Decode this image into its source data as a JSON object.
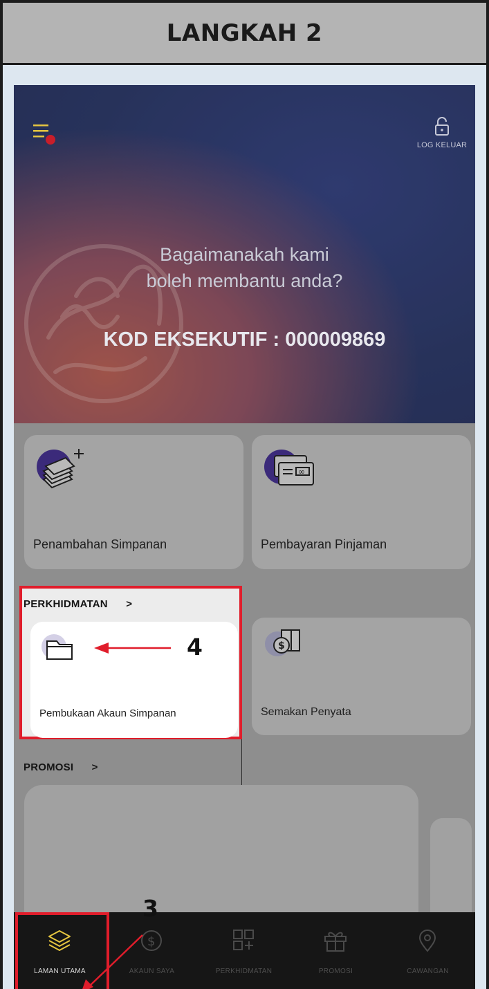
{
  "step": {
    "title": "LANGKAH 2"
  },
  "header": {
    "logout_label": "LOG KELUAR"
  },
  "hero": {
    "question_line1": "Bagaimanakah kami",
    "question_line2": "boleh membantu anda?",
    "executive_code": "KOD EKSEKUTIF : 000009869"
  },
  "quick_actions": [
    {
      "label": "Penambahan Simpanan",
      "icon": "money-stack-plus-icon"
    },
    {
      "label": "Pembayaran Pinjaman",
      "icon": "card-payment-icon"
    }
  ],
  "services": {
    "section_label": "PERKHIDMATAN",
    "chevron": ">",
    "items": [
      {
        "label": "Pembukaan Akaun Simpanan",
        "icon": "folder-icon"
      },
      {
        "label": "Semakan Penyata",
        "icon": "statement-icon"
      }
    ]
  },
  "promotions": {
    "section_label": "PROMOSI",
    "chevron": ">"
  },
  "tabbar": {
    "tabs": [
      {
        "label": "LAMAN UTAMA",
        "icon": "layers-icon",
        "active": true
      },
      {
        "label": "AKAUN SAYA",
        "icon": "dollar-circle-icon",
        "active": false
      },
      {
        "label": "PERKHIDMATAN",
        "icon": "grid-plus-icon",
        "active": false
      },
      {
        "label": "PROMOSI",
        "icon": "gift-icon",
        "active": false
      },
      {
        "label": "CAWANGAN",
        "icon": "location-pin-icon",
        "active": false
      }
    ]
  },
  "annotations": {
    "step3": "3",
    "step4": "4"
  },
  "colors": {
    "highlight": "#e01d2b",
    "accent_purple": "#3b2a7a",
    "active_icon": "#e6c640"
  }
}
